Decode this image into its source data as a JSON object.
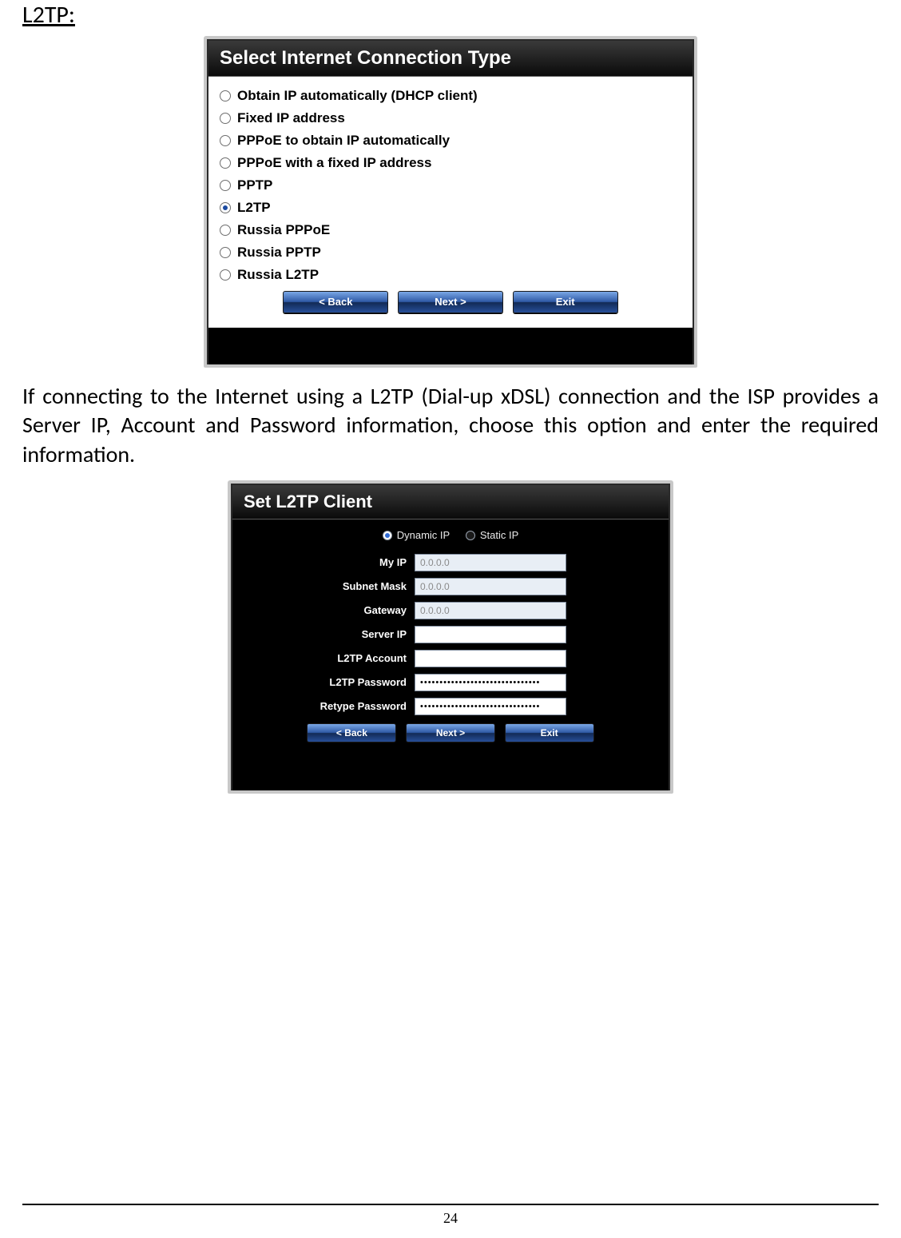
{
  "heading": "L2TP:",
  "paragraph": "If connecting to the Internet using a L2TP (Dial-up xDSL) connection and the ISP provides a Server IP, Account and Password information, choose this option and enter the required information.",
  "page_number": "24",
  "conn_panel": {
    "title": "Select Internet Connection Type",
    "options": [
      "Obtain IP automatically (DHCP client)",
      "Fixed IP address",
      "PPPoE to obtain IP automatically",
      "PPPoE with a fixed IP address",
      "PPTP",
      "L2TP",
      "Russia PPPoE",
      "Russia PPTP",
      "Russia L2TP"
    ],
    "selected_index": 5,
    "buttons": {
      "back": "< Back",
      "next": "Next >",
      "exit": "Exit"
    }
  },
  "l2tp_panel": {
    "title": "Set L2TP Client",
    "mode": {
      "dynamic": "Dynamic IP",
      "static": "Static IP",
      "selected": "dynamic"
    },
    "labels": {
      "my_ip": "My IP",
      "subnet": "Subnet Mask",
      "gateway": "Gateway",
      "server_ip": "Server IP",
      "account": "L2TP Account",
      "password": "L2TP Password",
      "retype": "Retype Password"
    },
    "values": {
      "my_ip": "0.0.0.0",
      "subnet": "0.0.0.0",
      "gateway": "0.0.0.0",
      "server_ip": "",
      "account": "",
      "password": "•••••••••••••••••••••••••••••••",
      "retype": "•••••••••••••••••••••••••••••••"
    },
    "buttons": {
      "back": "< Back",
      "next": "Next >",
      "exit": "Exit"
    }
  }
}
